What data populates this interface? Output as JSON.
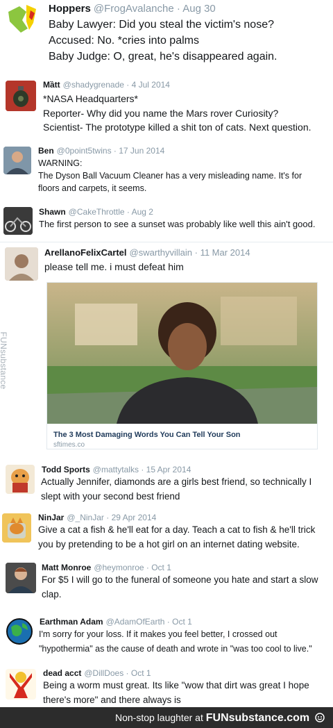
{
  "tweets": [
    {
      "name": "Hoppers",
      "handle": "@FrogAvalanche",
      "date": "Aug 30",
      "lines": [
        "Baby Lawyer: Did you steal the victim's nose?",
        "Accused: No. *cries into palms",
        "Baby Judge: O, great, he's disappeared again."
      ]
    },
    {
      "name": "Mȁtt",
      "handle": "@shadygrenade",
      "date": "4 Jul 2014",
      "lines": [
        "*NASA Headquarters*",
        "Reporter- Why did you name the Mars rover Curiosity?",
        "Scientist- The prototype killed a shit ton of cats. Next question."
      ]
    },
    {
      "name": "Ben",
      "handle": "@0point5twins",
      "date": "17 Jun 2014",
      "lines": [
        "WARNING:",
        "The Dyson Ball Vacuum Cleaner has a very misleading name. It's for",
        "floors and carpets, it seems."
      ]
    },
    {
      "name": "Shawn",
      "handle": "@CakeThrottle",
      "date": "Aug 2",
      "lines": [
        "The first person to see a sunset was probably like well this ain't good."
      ]
    },
    {
      "name": "ArellanoFelixCartel",
      "handle": "@swarthyvillain",
      "date": "11 Mar 2014",
      "lines": [
        "please tell me. i must defeat him"
      ]
    },
    {
      "name": "Todd Sports",
      "handle": "@mattytalks",
      "date": "15 Apr 2014",
      "lines": [
        "Actually Jennifer, diamonds are a girls  best friend, so technically I",
        "slept with your second best friend"
      ]
    },
    {
      "name": "NinJar",
      "handle": "@_NinJar",
      "date": "29 Apr 2014",
      "lines": [
        "Give a cat a fish & he'll eat for a day. Teach a cat to fish & he'll trick",
        "you by pretending to be a hot girl on an internet dating website."
      ]
    },
    {
      "name": "Matt Monroe",
      "handle": "@heymonroe",
      "date": "Oct 1",
      "lines": [
        "For $5 I will go to the funeral of someone you hate and start a slow",
        "clap."
      ]
    },
    {
      "name": "Earthman Adam",
      "handle": "@AdamOfEarth",
      "date": "Oct 1",
      "lines": [
        "I'm sorry for your loss. If it makes you feel better, I crossed out",
        "\"hypothermia\" as the cause of death and wrote in \"was too cool to live.\""
      ]
    },
    {
      "name": "dead acct",
      "handle": "@DillDoes",
      "date": "Oct 1",
      "lines": [
        "Being a worm must great. Its like \"wow that dirt was great I hope",
        "there's more\" and there always is"
      ]
    }
  ],
  "card": {
    "title": "The 3 Most Damaging Words You Can Tell Your Son",
    "domain": "sftimes.co"
  },
  "watermark": {
    "side": "FUNsubstance"
  },
  "footer": {
    "tagline": "Non-stop laughter at",
    "brand": "FUNsubstance.com"
  },
  "colors": {
    "meta": "#8899a6",
    "text": "#14171a",
    "footer_bg": "#2c2c2c"
  }
}
